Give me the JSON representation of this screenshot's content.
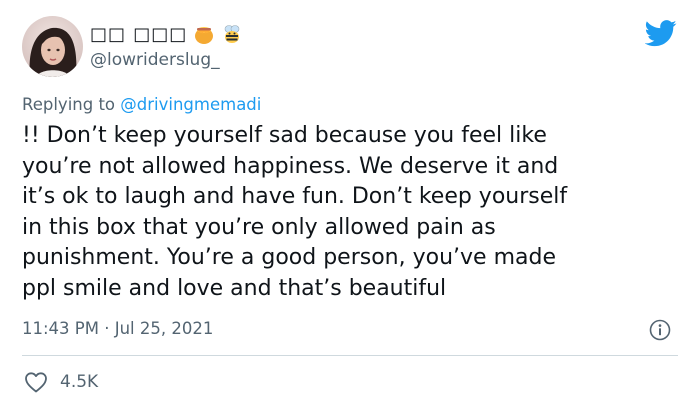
{
  "author": {
    "display_name": "□□ □□□",
    "handle": "@lowriderslug_",
    "avatar_icon": "avatar-photo",
    "name_emojis": [
      "honey-pot-icon",
      "bee-icon"
    ]
  },
  "reply": {
    "prefix": "Replying to ",
    "mention": "@drivingmemadi"
  },
  "tweet": {
    "text": "!! Don’t keep yourself sad because you feel like\nyou’re not allowed happiness. We deserve it and\nit’s ok to laugh and have fun. Don’t keep yourself\nin this box that you’re only allowed pain as\npunishment. You’re a good person, you’ve made\nppl smile and love and that’s beautiful"
  },
  "meta": {
    "timestamp": "11:43 PM · Jul 25, 2021"
  },
  "stats": {
    "likes": "4.5K"
  },
  "colors": {
    "brand_blue": "#1d9bf0",
    "secondary_text": "#536471",
    "primary_text": "#0f1419",
    "divider": "#cfd9de"
  }
}
